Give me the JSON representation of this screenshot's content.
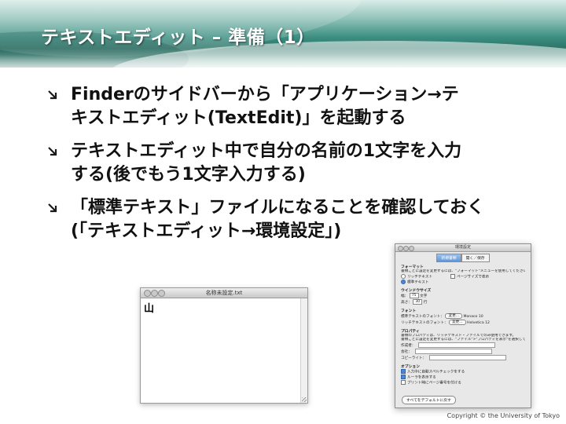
{
  "title": "テキストエディット – 準備（1）",
  "bullets": [
    {
      "lines": [
        "Finderのサイドバーから「アプリケーション→テ",
        "キストエディット(TextEdit)」を起動する"
      ]
    },
    {
      "lines": [
        "テキストエディット中で自分の名前の1文字を入力",
        "する(後でもう1文字入力する)"
      ]
    },
    {
      "lines": [
        "「標準テキスト」ファイルになることを確認しておく",
        "(「テキストエディット→環境設定」)"
      ]
    }
  ],
  "edit_window": {
    "title": "名称未設定.txt",
    "content": "山"
  },
  "prefs": {
    "title": "環境設定",
    "tabs": [
      "新規書類",
      "開く／保存"
    ],
    "format_header": "フォーマット",
    "format_desc": "書類ごとに設定を変更するには、\"フォーマット\"メニューを使用してください。",
    "rich_text": "リッチテキスト",
    "page_wide": "ページサイズで表示",
    "plain_text": "標準テキスト",
    "window_size_header": "ウインドウサイズ",
    "width_label": "幅：",
    "width_value": "75",
    "chars": "文字",
    "height_label": "高さ：",
    "height_value": "30",
    "lines": "行",
    "font_header": "フォント",
    "plain_font_label": "標準テキストのフォント：",
    "plain_font_btn": "変更...",
    "plain_font_value": "Monaco 10",
    "rich_font_label": "リッチテキストのフォント：",
    "rich_font_btn": "変更...",
    "rich_font_value": "Helvetica 12",
    "props_header": "プロパティ",
    "props_desc1": "書類のプロパティは、リッチテキスト・ファイルでのみ使用できます。",
    "props_desc2": "書類ごとに設定を変更するには、\"ファイル\">\"プロパティを表示\"を選択してください。",
    "author_label": "作成者：",
    "company_label": "会社：",
    "copyright_label": "コピーライト：",
    "options_header": "オプション",
    "opt1": "入力中に自動スペルチェックをする",
    "opt2": "ルーラを表示する",
    "opt3": "プリント時にページ番号を付ける",
    "reset_button": "すべてをデフォルトに戻す"
  },
  "copyright": "Copyright © the University of Tokyo",
  "colors": {
    "band_dark": "#2c7366",
    "band_light": "#d9ece8",
    "bullet_arrow": "#1a1a1a"
  }
}
